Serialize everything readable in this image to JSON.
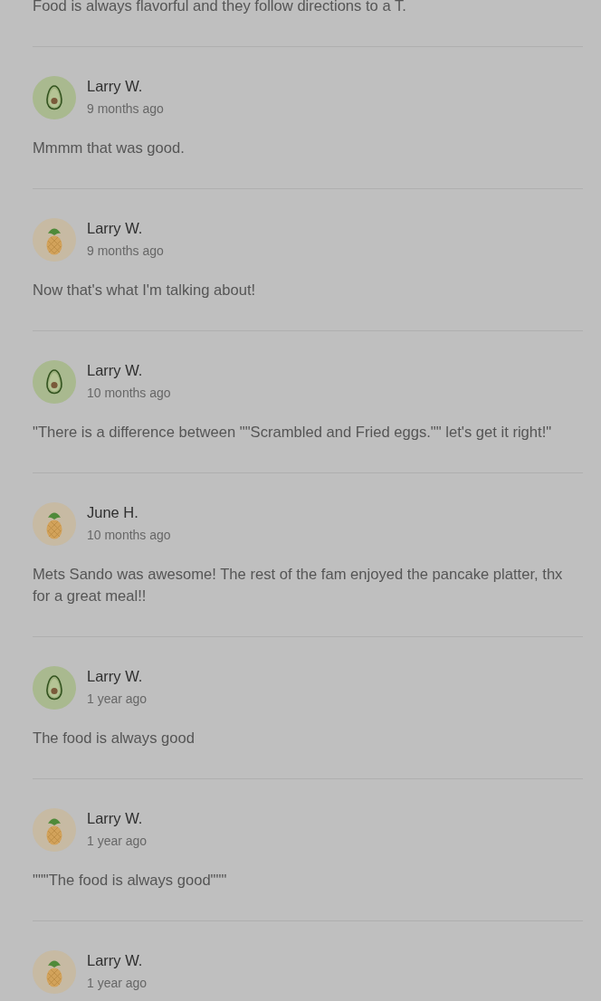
{
  "partial_review": {
    "text": "Food is always flavorful and they follow directions to a T."
  },
  "reviews": [
    {
      "name": "Larry W.",
      "time": "9 months ago",
      "avatar": {
        "kind": "avocado"
      },
      "text": "Mmmm that was good."
    },
    {
      "name": "Larry W.",
      "time": "9 months ago",
      "avatar": {
        "kind": "pineapple"
      },
      "text": "Now that's what I'm talking about!"
    },
    {
      "name": "Larry W.",
      "time": "10 months ago",
      "avatar": {
        "kind": "avocado"
      },
      "text": "\"There is a difference between \"\"Scrambled and Fried eggs.\"\" let's get it right!\""
    },
    {
      "name": "June H.",
      "time": "10 months ago",
      "avatar": {
        "kind": "pineapple"
      },
      "text": "Mets Sando was awesome! The rest of the fam enjoyed the pancake platter, thx for a great meal!!"
    },
    {
      "name": "Larry W.",
      "time": "1 year ago",
      "avatar": {
        "kind": "avocado"
      },
      "text": "The food is always good"
    },
    {
      "name": "Larry W.",
      "time": "1 year ago",
      "avatar": {
        "kind": "pineapple"
      },
      "text": "\"\"\"The food is always good\"\"\""
    },
    {
      "name": "Larry W.",
      "time": "1 year ago",
      "avatar": {
        "kind": "pineapple"
      }
    }
  ]
}
